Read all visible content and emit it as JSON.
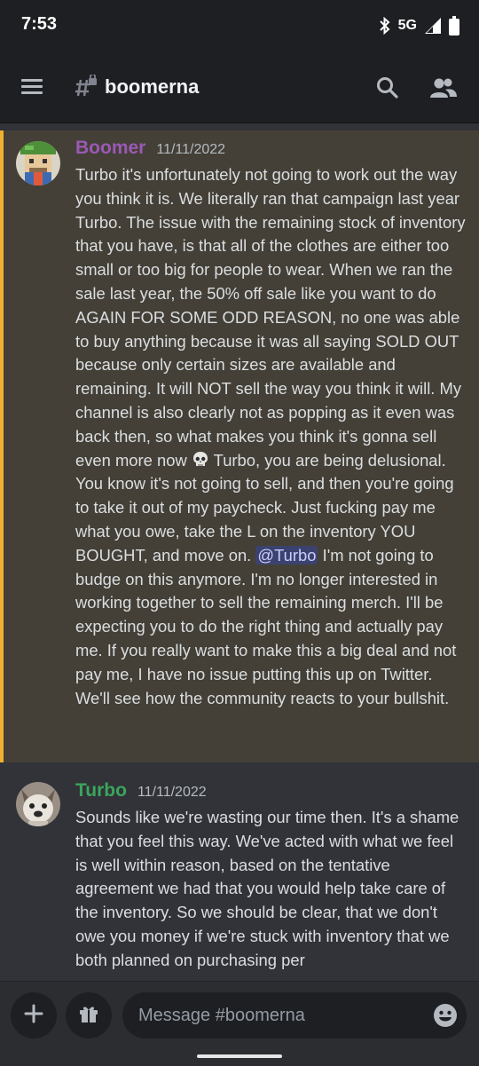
{
  "status_bar": {
    "time": "7:53",
    "network": "5G"
  },
  "header": {
    "channel_name": "boomerna"
  },
  "colors": {
    "boomer_name": "#9b59b6",
    "turbo_name": "#3ba55c",
    "mention_bg": "#3c4270",
    "highlight_border": "#f0b132"
  },
  "icons": [
    "hamburger-menu-icon",
    "locked-hashtag-icon",
    "search-icon",
    "members-icon",
    "bluetooth-icon",
    "signal-icon",
    "battery-icon",
    "plus-icon",
    "gift-icon",
    "emoji-icon",
    "skull-emoji"
  ],
  "messages": [
    {
      "author": "Boomer",
      "timestamp": "11/11/2022",
      "highlighted": true,
      "text_before_skull": "Turbo it's unfortunately not going to work out the way you think it is. We literally ran that campaign last year Turbo. The issue with the remaining stock of inventory that you have, is that all of the clothes are either too small or too big for people to wear. When we ran the sale last year, the 50% off sale like you want to do AGAIN FOR SOME ODD REASON, no one was able to buy anything because it was all saying SOLD OUT because only certain sizes are available and remaining. It will NOT sell the way you think it will. My channel is also clearly not as popping as it even was back then, so what makes you think it's gonna sell even more now",
      "text_after_skull": "Turbo, you are being delusional. You know it's not going to sell, and then you're going to take it out of my paycheck. Just fucking pay me what you owe, take the L on the inventory YOU BOUGHT, and move on.",
      "mention": "@Turbo",
      "text_after_mention": "I'm not going to budge on this anymore. I'm no longer interested in working together to sell the remaining merch. I'll be expecting you to do the right thing and actually pay me. If you really want to make this a big deal and not pay me, I have no issue putting this up on Twitter. We'll see how the community reacts to your bullshit."
    },
    {
      "author": "Turbo",
      "timestamp": "11/11/2022",
      "highlighted": false,
      "text": "Sounds like we're wasting our time then. It's a shame that you feel this way. We've acted with what we feel is well within reason, based on the tentative agreement we had that you would help take care of the inventory. So we should be clear, that we don't owe you money if we're stuck with inventory that we both planned on purchasing per"
    }
  ],
  "composer": {
    "placeholder": "Message #boomerna"
  }
}
